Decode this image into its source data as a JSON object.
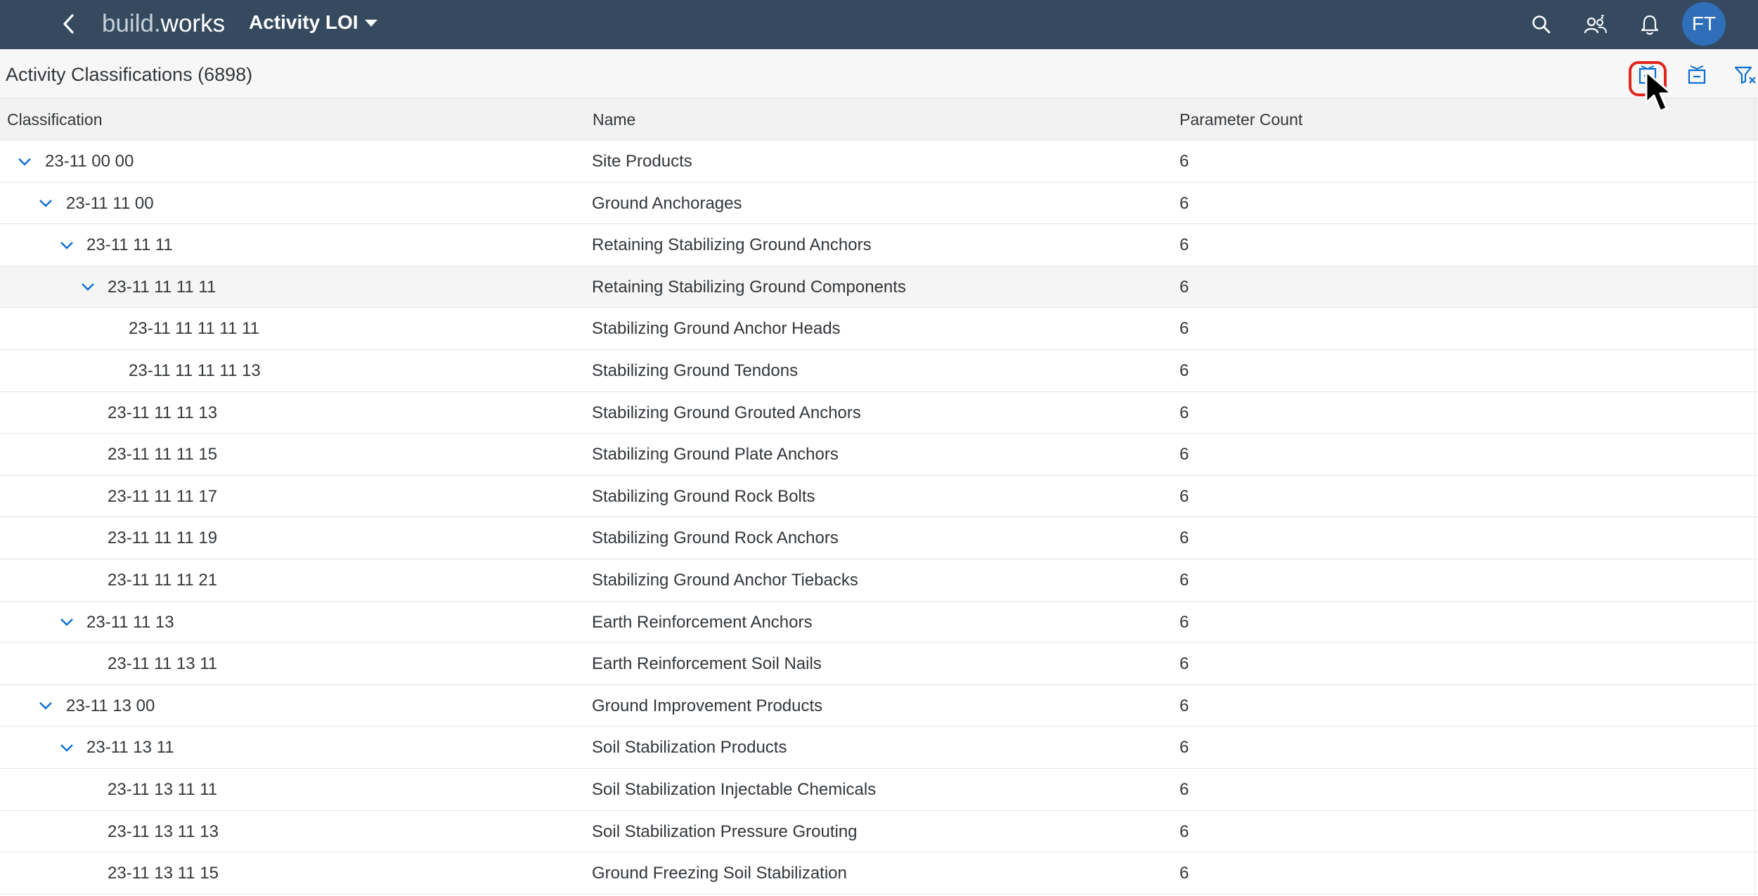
{
  "shell": {
    "logo_part1": "build.",
    "logo_part2": "works",
    "app_title": "Activity LOI",
    "avatar_initials": "FT",
    "icons": [
      "back-icon",
      "search-icon",
      "user-group-icon",
      "bell-icon"
    ]
  },
  "subheader": {
    "title": "Activity Classifications (6898)",
    "toolbar_icons": [
      "expand-all-icon",
      "collapse-all-icon",
      "clear-filter-icon"
    ],
    "highlight_color": "#e0261f"
  },
  "table": {
    "columns": [
      "Classification",
      "Name",
      "Parameter Count"
    ],
    "rows": [
      {
        "classification": "23-11 00 00",
        "name": "Site Products",
        "count": "6"
      },
      {
        "classification": "23-11 11 00",
        "name": "Ground Anchorages",
        "count": "6"
      },
      {
        "classification": "23-11 11 11",
        "name": "Retaining Stabilizing Ground Anchors",
        "count": "6"
      },
      {
        "classification": "23-11 11 11 11",
        "name": "Retaining Stabilizing Ground Components",
        "count": "6"
      },
      {
        "classification": "23-11 11 11 11 11",
        "name": "Stabilizing Ground Anchor Heads",
        "count": "6"
      },
      {
        "classification": "23-11 11 11 11 13",
        "name": "Stabilizing Ground Tendons",
        "count": "6"
      },
      {
        "classification": "23-11 11 11 13",
        "name": "Stabilizing Ground Grouted Anchors",
        "count": "6"
      },
      {
        "classification": "23-11 11 11 15",
        "name": "Stabilizing Ground Plate Anchors",
        "count": "6"
      },
      {
        "classification": "23-11 11 11 17",
        "name": "Stabilizing Ground Rock Bolts",
        "count": "6"
      },
      {
        "classification": "23-11 11 11 19",
        "name": "Stabilizing Ground Rock Anchors",
        "count": "6"
      },
      {
        "classification": "23-11 11 11 21",
        "name": "Stabilizing Ground Anchor Tiebacks",
        "count": "6"
      },
      {
        "classification": "23-11 11 13",
        "name": "Earth Reinforcement Anchors",
        "count": "6"
      },
      {
        "classification": "23-11 11 13 11",
        "name": "Earth Reinforcement Soil Nails",
        "count": "6"
      },
      {
        "classification": "23-11 13 00",
        "name": "Ground Improvement Products",
        "count": "6"
      },
      {
        "classification": "23-11 13 11",
        "name": "Soil Stabilization Products",
        "count": "6"
      },
      {
        "classification": "23-11 13 11 11",
        "name": "Soil Stabilization Injectable Chemicals",
        "count": "6"
      },
      {
        "classification": "23-11 13 11 13",
        "name": "Soil Stabilization Pressure Grouting",
        "count": "6"
      },
      {
        "classification": "23-11 13 11 15",
        "name": "Ground Freezing Soil Stabilization",
        "count": "6"
      }
    ]
  }
}
